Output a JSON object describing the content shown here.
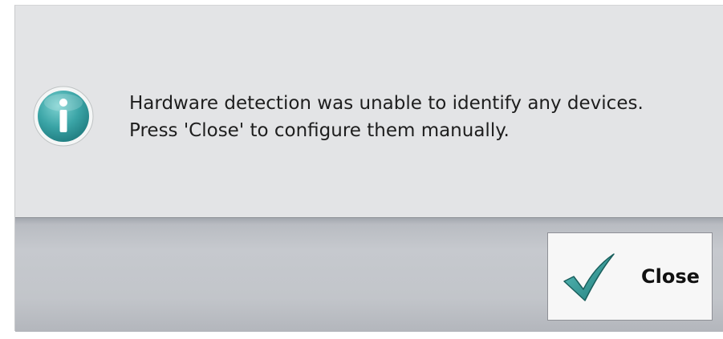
{
  "dialog": {
    "icon": "info-icon",
    "message_lines": [
      "Hardware detection was unable to identify any devices.",
      "Press 'Close' to configure them manually."
    ]
  },
  "buttons": {
    "close": {
      "label": "Close",
      "icon": "checkmark-icon"
    }
  },
  "colors": {
    "dialog_background": "#e3e4e6",
    "icon_teal": "#3a9c9e",
    "checkmark_teal": "#2f8f8c",
    "button_bar": "#c2c5ca"
  }
}
